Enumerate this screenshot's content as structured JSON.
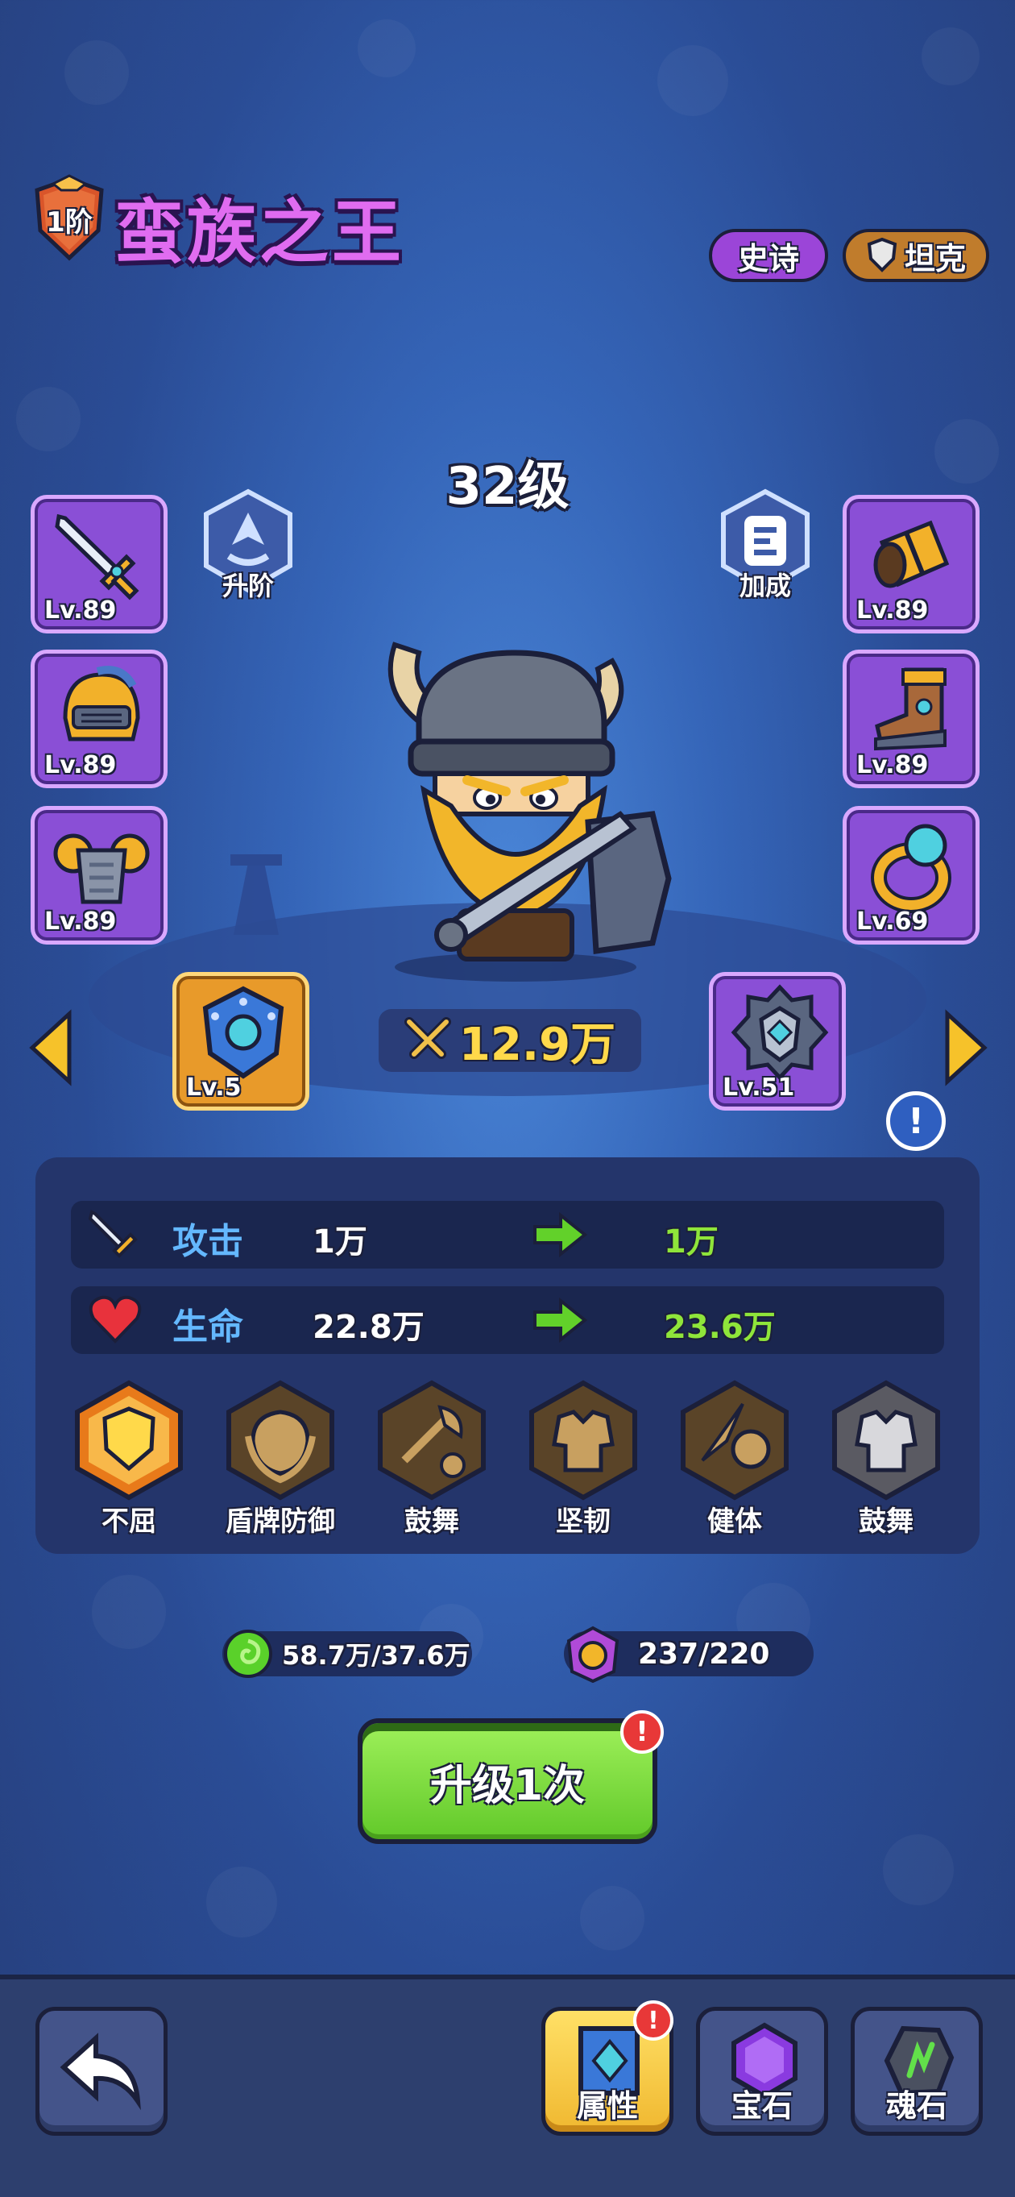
{
  "header": {
    "tier": "1阶",
    "hero_name": "蛮族之王",
    "rarity": "史诗",
    "role": "坦克"
  },
  "hero": {
    "level": "32级",
    "ascend_label": "升阶",
    "bonus_label": "加成",
    "power": "12.9万"
  },
  "equipment": {
    "left": [
      {
        "icon": "sword-icon",
        "level": "Lv.89"
      },
      {
        "icon": "helmet-icon",
        "level": "Lv.89"
      },
      {
        "icon": "armor-icon",
        "level": "Lv.89"
      }
    ],
    "right": [
      {
        "icon": "bracer-icon",
        "level": "Lv.89"
      },
      {
        "icon": "boots-icon",
        "level": "Lv.89"
      },
      {
        "icon": "ring-icon",
        "level": "Lv.69"
      }
    ],
    "artifact_left": {
      "icon": "shield-artifact-icon",
      "level": "Lv.5"
    },
    "artifact_right": {
      "icon": "spiked-shield-icon",
      "level": "Lv.51"
    }
  },
  "stats": [
    {
      "icon": "sword-icon",
      "name": "攻击",
      "current": "1万",
      "next": "1万"
    },
    {
      "icon": "heart-icon",
      "name": "生命",
      "current": "22.8万",
      "next": "23.6万"
    }
  ],
  "skills": [
    {
      "icon": "golden-shield-icon",
      "name": "不屈"
    },
    {
      "icon": "shield-guard-icon",
      "name": "盾牌防御"
    },
    {
      "icon": "axe-skull-icon",
      "name": "鼓舞"
    },
    {
      "icon": "armor-vest-icon",
      "name": "坚韧"
    },
    {
      "icon": "spirit-burst-icon",
      "name": "健体"
    },
    {
      "icon": "cloth-armor-icon",
      "name": "鼓舞"
    }
  ],
  "resources": {
    "gold": "58.7万/37.6万",
    "hero_shards": "237/220"
  },
  "upgrade_button": "升级1次",
  "bottom_nav": [
    {
      "icon": "back-arrow-icon",
      "label": ""
    },
    {
      "icon": "attribute-book-icon",
      "label": "属性"
    },
    {
      "icon": "gem-icon",
      "label": "宝石"
    },
    {
      "icon": "soul-stone-icon",
      "label": "魂石"
    }
  ],
  "colors": {
    "accent_purple": "#9b45d8",
    "stat_name_blue": "#64b8ff",
    "upgrade_green": "#8fe53a",
    "power_gold": "#ffd94a"
  }
}
